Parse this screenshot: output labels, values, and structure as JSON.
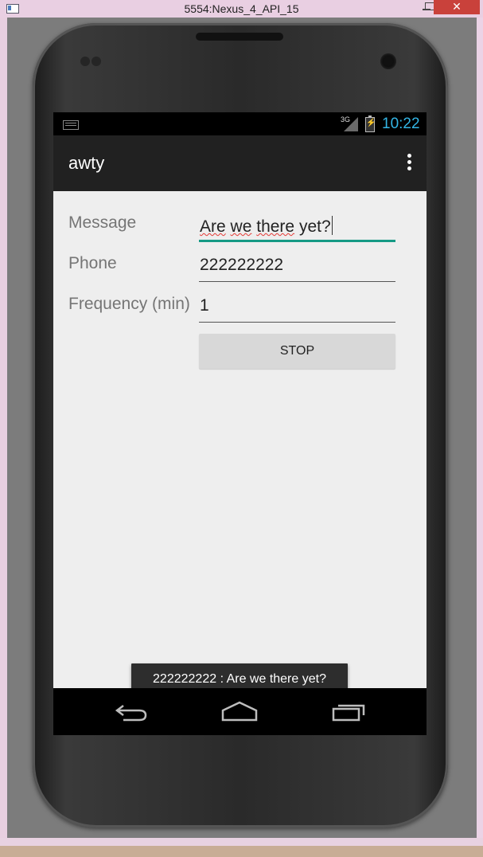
{
  "window": {
    "title": "5554:Nexus_4_API_15",
    "close_glyph": "✕"
  },
  "statusbar": {
    "time": "10:22",
    "network_label": "3G"
  },
  "actionbar": {
    "title": "awty"
  },
  "form": {
    "message": {
      "label": "Message",
      "value_words": [
        "Are",
        "we",
        "there"
      ],
      "value_tail": "yet?"
    },
    "phone": {
      "label": "Phone",
      "value": "222222222"
    },
    "frequency": {
      "label": "Frequency (min)",
      "value": "1"
    },
    "stop_button_label": "STOP"
  },
  "toast": {
    "text": "222222222 : Are we there yet?"
  },
  "icons": {
    "keyboard": "keyboard-icon",
    "signal": "signal-icon",
    "battery": "battery-charging-icon",
    "overflow": "overflow-menu-icon",
    "back": "back-icon",
    "home": "home-icon",
    "recents": "recent-apps-icon"
  },
  "colors": {
    "accent": "#159a85",
    "clock": "#33b5e5",
    "actionbar": "#212121",
    "screen_bg": "#eeeeee"
  }
}
